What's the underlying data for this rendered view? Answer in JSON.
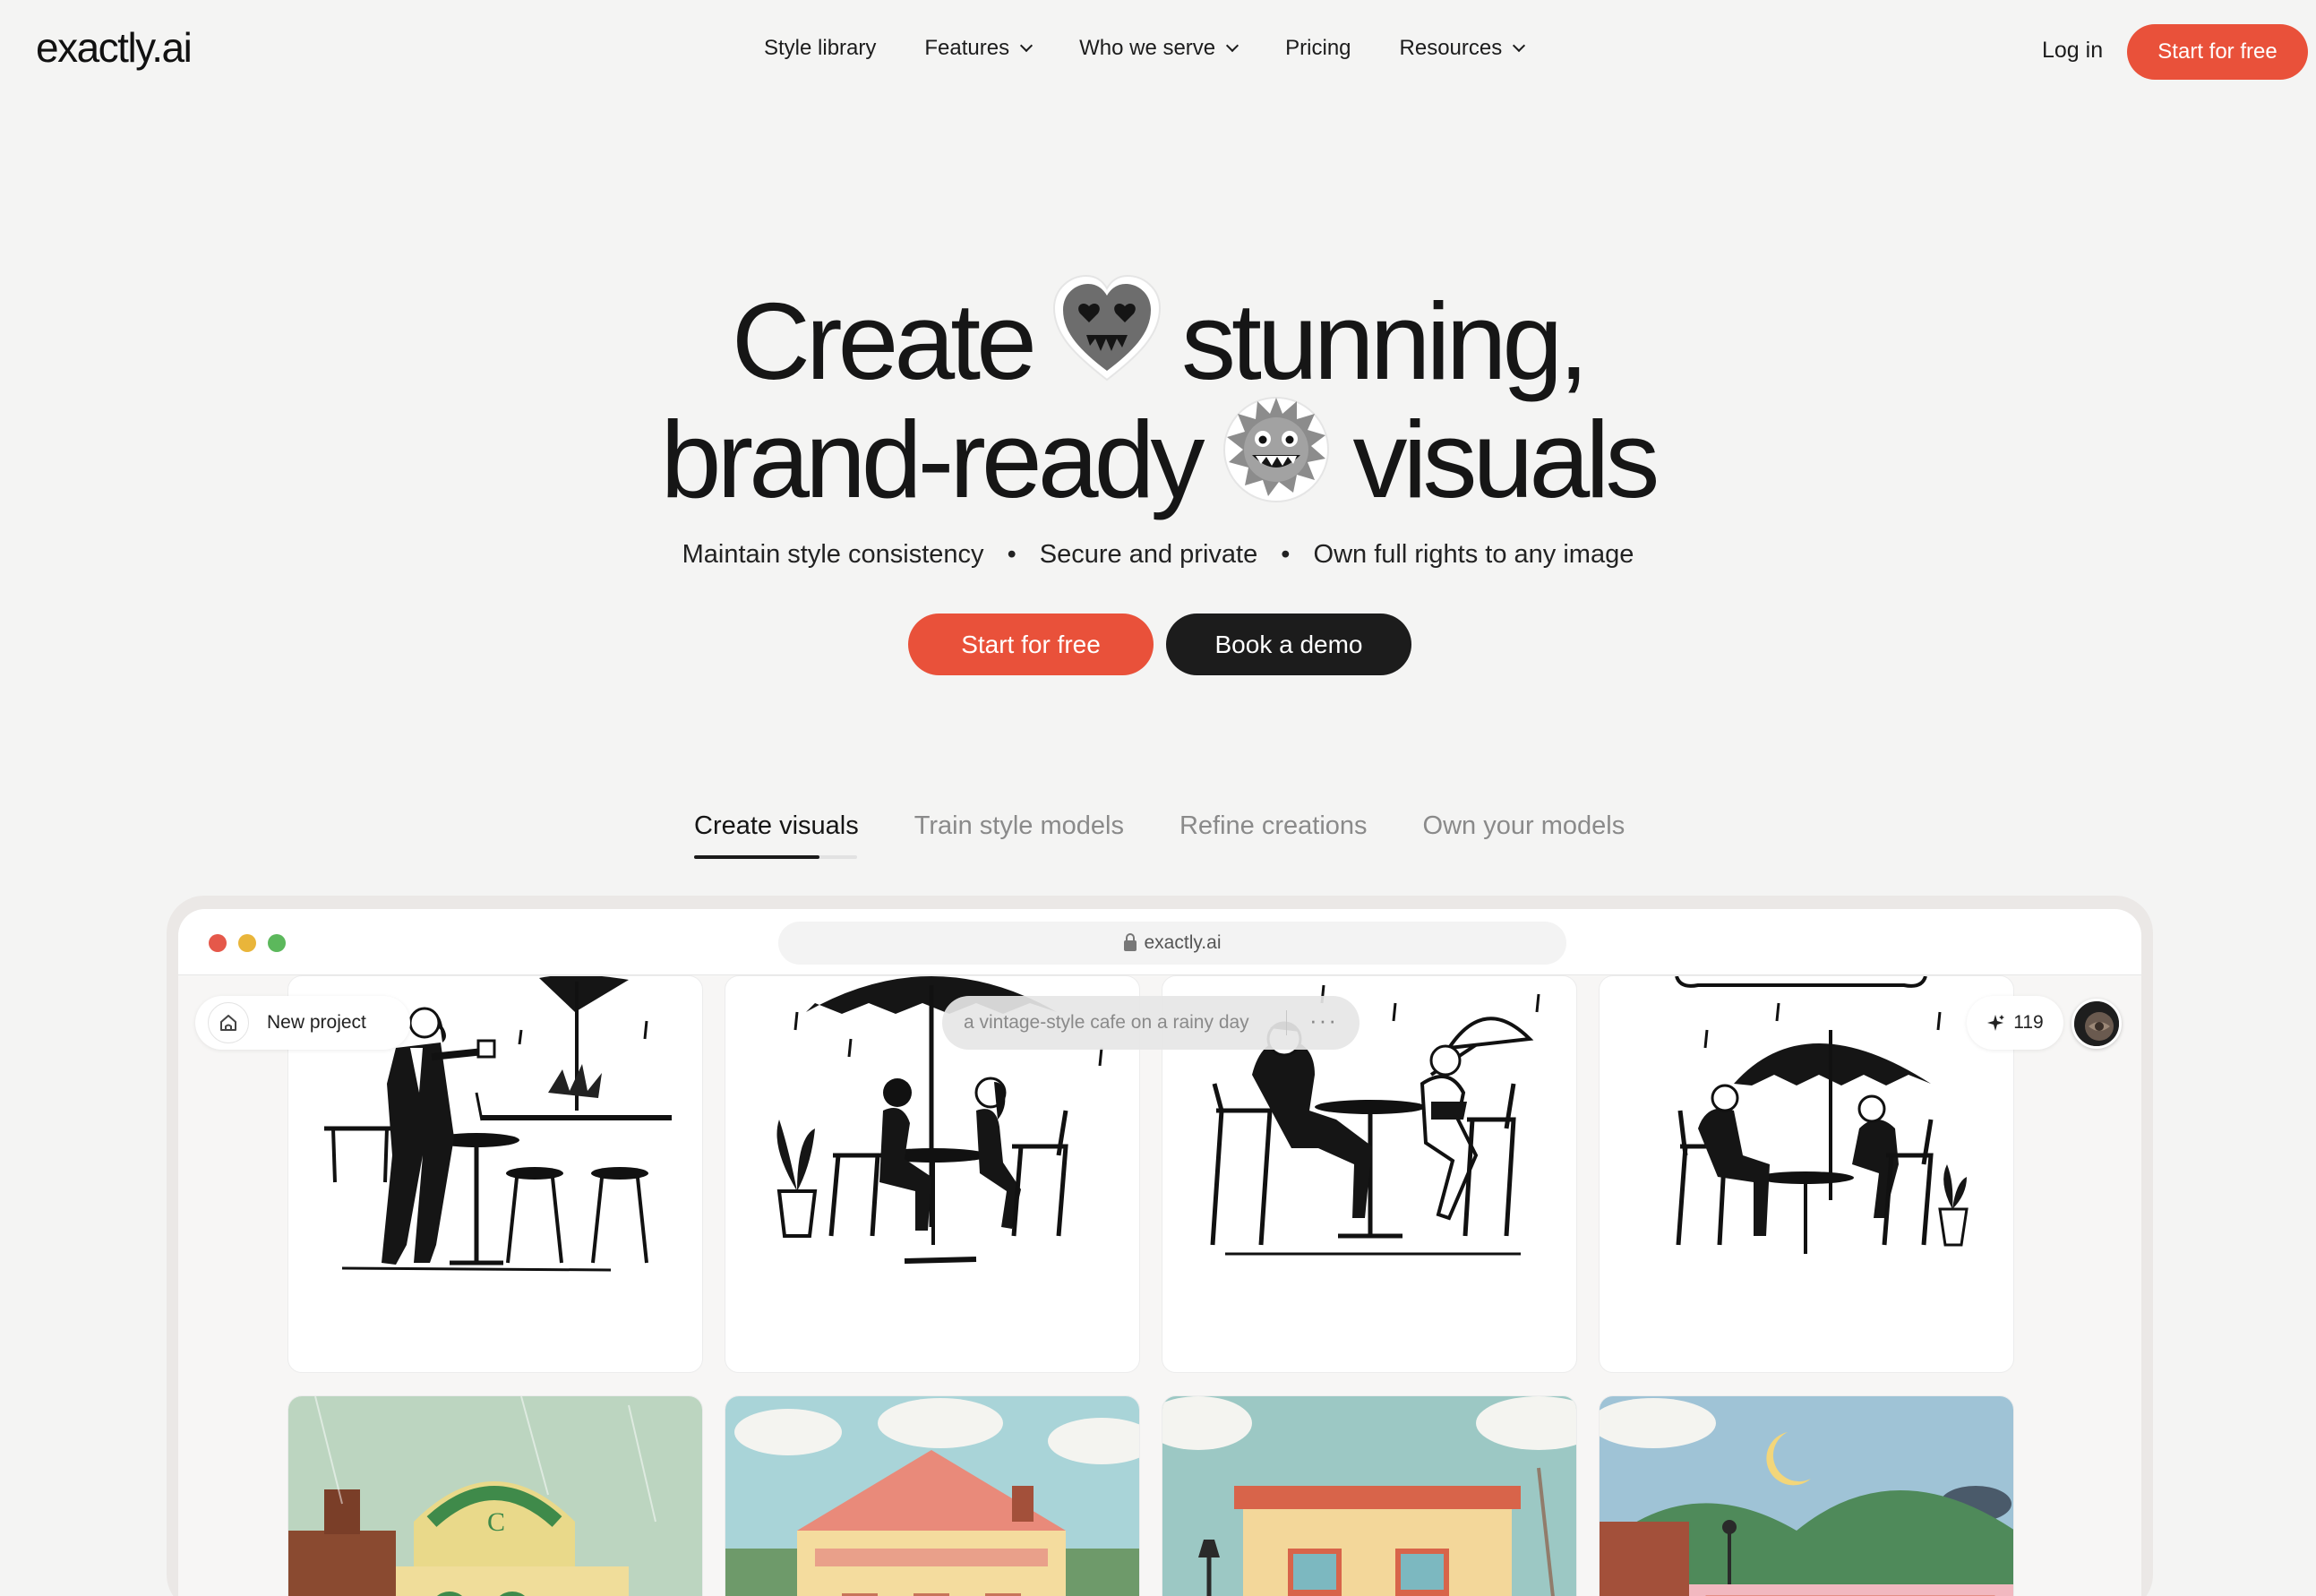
{
  "nav": {
    "logo": "exactly.ai",
    "links": [
      {
        "label": "Style library",
        "dropdown": false
      },
      {
        "label": "Features",
        "dropdown": true
      },
      {
        "label": "Who we serve",
        "dropdown": true
      },
      {
        "label": "Pricing",
        "dropdown": false
      },
      {
        "label": "Resources",
        "dropdown": true
      }
    ],
    "login": "Log in",
    "cta": "Start for free"
  },
  "hero": {
    "line1_a": "Create",
    "line1_b": "stunning,",
    "line2_a": "brand-ready",
    "line2_b": "visuals",
    "sub": [
      "Maintain style consistency",
      "Secure and private",
      "Own full rights to any image"
    ],
    "separator": "•",
    "primary_cta": "Start for free",
    "secondary_cta": "Book a demo"
  },
  "tabs": [
    {
      "label": "Create visuals",
      "active": true
    },
    {
      "label": "Train style models",
      "active": false
    },
    {
      "label": "Refine creations",
      "active": false
    },
    {
      "label": "Own your models",
      "active": false
    }
  ],
  "browser": {
    "url": "exactly.ai",
    "project_label": "New project",
    "prompt": "a vintage-style cafe on a rainy day",
    "prompt_more": "···",
    "credits": "119"
  },
  "colors": {
    "accent": "#e9513a",
    "dark": "#1c1c1c",
    "background": "#f4f4f3"
  }
}
